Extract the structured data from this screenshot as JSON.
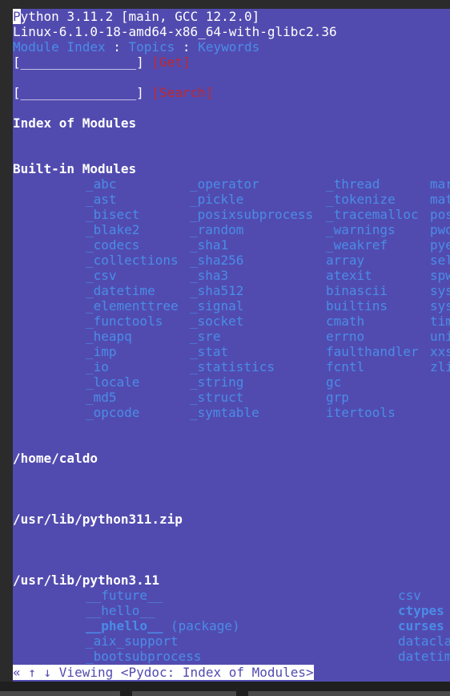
{
  "header": {
    "python_version_rest": "ython 3.11.2 [main, GCC 12.2.0]",
    "python_version_first": "P",
    "platform": "Linux-6.1.0-18-amd64-x86_64-with-glibc2.36",
    "nav": {
      "module_index": "Module Index",
      "sep1": " : ",
      "topics": "Topics",
      "sep2": " : ",
      "keywords": "Keywords"
    }
  },
  "forms": {
    "get_field": "[_______________]",
    "get_button": "[Get]",
    "search_field": "[_______________]",
    "search_button": "[Search]"
  },
  "title": "Index of Modules",
  "builtin": {
    "heading": "Built-in Modules",
    "col1": [
      "_abc",
      "_ast",
      "_bisect",
      "_blake2",
      "_codecs",
      "_collections",
      "_csv",
      "_datetime",
      "_elementtree",
      "_functools",
      "_heapq",
      "_imp",
      "_io",
      "_locale",
      "_md5",
      "_opcode"
    ],
    "col2": [
      "_operator",
      "_pickle",
      "_posixsubprocess",
      "_random",
      "_sha1",
      "_sha256",
      "_sha3",
      "_sha512",
      "_signal",
      "_socket",
      "_sre",
      "_stat",
      "_statistics",
      "_string",
      "_struct",
      "_symtable"
    ],
    "col3": [
      "_thread",
      "_tokenize",
      "_tracemalloc",
      "_warnings",
      "_weakref",
      "array",
      "atexit",
      "binascii",
      "builtins",
      "cmath",
      "errno",
      "faulthandler",
      "fcntl",
      "gc",
      "grp",
      "itertools"
    ],
    "col4": [
      "mar",
      "mat",
      "pos",
      "pwd",
      "pye",
      "sel",
      "spw",
      "sys",
      "sys",
      "tim",
      "uni",
      "xxs",
      "zli"
    ]
  },
  "paths": {
    "home": "/home/caldo",
    "zip": "/usr/lib/python311.zip",
    "lib": "/usr/lib/python3.11"
  },
  "lib_modules": {
    "col1": [
      {
        "name": "__future__",
        "style": "link",
        "suffix": ""
      },
      {
        "name": "__hello__",
        "style": "link",
        "suffix": ""
      },
      {
        "name": "__phello__",
        "style": "link-bold",
        "suffix": " (package)"
      },
      {
        "name": "_aix_support",
        "style": "link",
        "suffix": ""
      },
      {
        "name": "_bootsubprocess",
        "style": "link",
        "suffix": ""
      }
    ],
    "col2": [
      {
        "name": "csv",
        "style": "link"
      },
      {
        "name": "ctypes",
        "style": "link-bold"
      },
      {
        "name": "curses",
        "style": "link-bold"
      },
      {
        "name": "datacla",
        "style": "link"
      },
      {
        "name": "datetim",
        "style": "link"
      }
    ]
  },
  "status_bar": "« ↑ ↓ Viewing <Pydoc: Index of Modules>"
}
